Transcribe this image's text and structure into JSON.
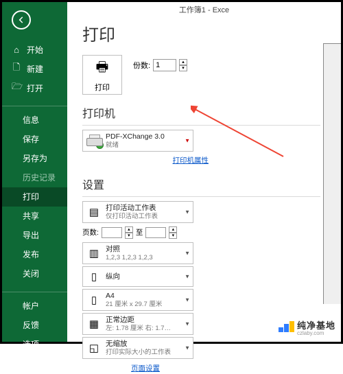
{
  "titlebar": "工作簿1 - Exce",
  "page_title": "打印",
  "sidebar": {
    "items_top": [
      {
        "icon": "⌂",
        "label": "开始"
      },
      {
        "icon": "🗋",
        "label": "新建"
      },
      {
        "icon": "🗁",
        "label": "打开"
      }
    ],
    "items_mid": [
      {
        "label": "信息",
        "dim": false
      },
      {
        "label": "保存",
        "dim": false
      },
      {
        "label": "另存为",
        "dim": false
      },
      {
        "label": "历史记录",
        "dim": true
      },
      {
        "label": "打印",
        "active": true
      },
      {
        "label": "共享",
        "dim": false
      },
      {
        "label": "导出",
        "dim": false
      },
      {
        "label": "发布",
        "dim": false
      },
      {
        "label": "关闭",
        "dim": false
      }
    ],
    "items_bottom": [
      {
        "label": "帐户"
      },
      {
        "label": "反馈"
      },
      {
        "label": "选项"
      }
    ]
  },
  "print_button": {
    "label": "打印"
  },
  "copies": {
    "label": "份数:",
    "value": "1"
  },
  "printer_section": {
    "title": "打印机"
  },
  "printer_selected": {
    "name": "PDF-XChange 3.0",
    "status": "就绪"
  },
  "printer_props_link": "打印机属性",
  "settings_section": {
    "title": "设置"
  },
  "settings": [
    {
      "name": "scope-combo",
      "title": "打印活动工作表",
      "sub": "仅打印活动工作表"
    }
  ],
  "pages": {
    "label": "页数:",
    "to": "至"
  },
  "settings2": [
    {
      "name": "collate-combo",
      "title": "对照",
      "sub": "1,2,3   1,2,3   1,2,3"
    },
    {
      "name": "orientation-combo",
      "title": "纵向",
      "sub": ""
    },
    {
      "name": "paper-combo",
      "title": "A4",
      "sub": "21 厘米 x 29.7 厘米"
    },
    {
      "name": "margins-combo",
      "title": "正常边距",
      "sub": "左: 1.78 厘米  右: 1.7…"
    },
    {
      "name": "scaling-combo",
      "title": "无缩放",
      "sub": "打印实际大小的工作表"
    }
  ],
  "page_setup_link": "页面设置",
  "watermark": {
    "zh": "纯净基地",
    "en": "czlaby.com"
  }
}
